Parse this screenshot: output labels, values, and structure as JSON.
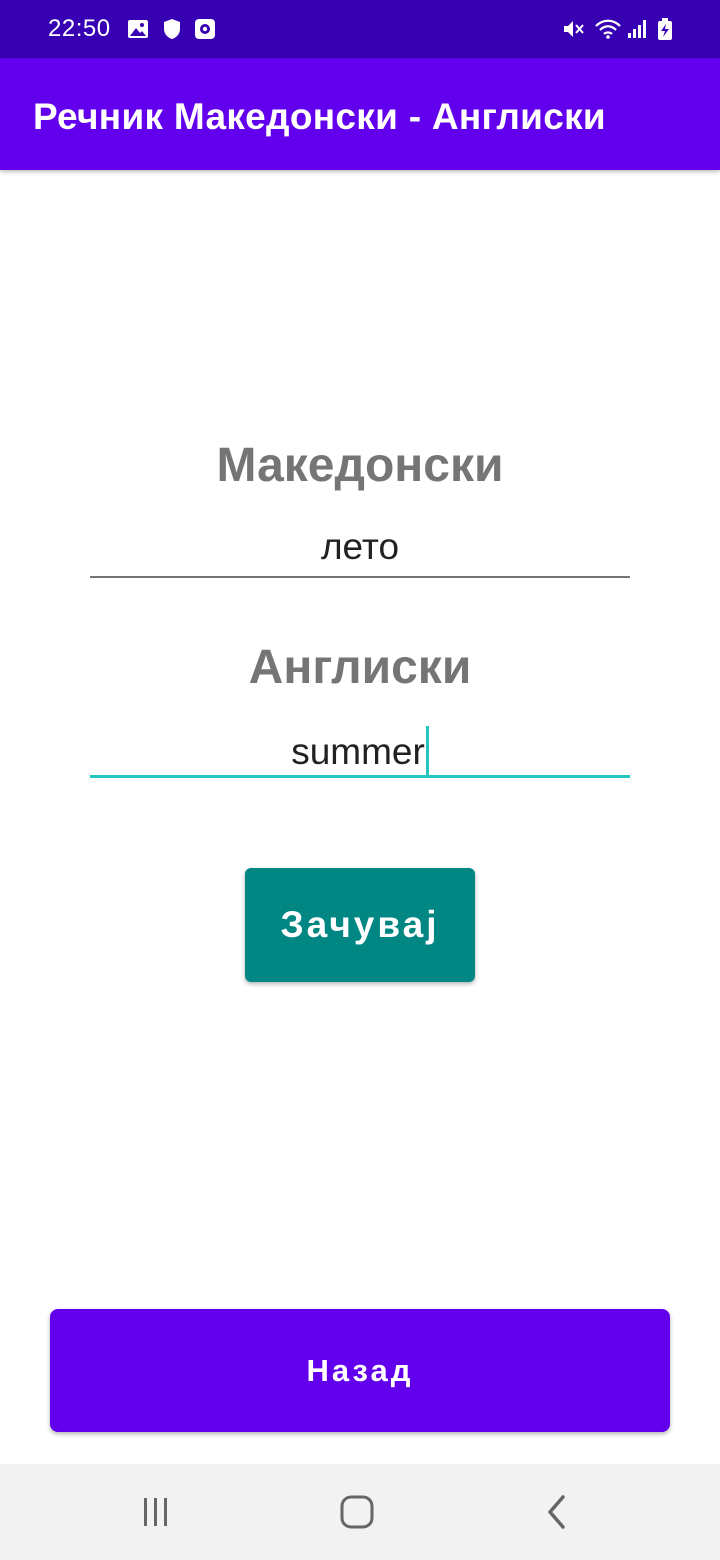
{
  "status_bar": {
    "time": "22:50",
    "left_icons": [
      "image-icon",
      "shield-icon",
      "screen-record-icon"
    ],
    "right_icons": [
      "mute-icon",
      "wifi-icon",
      "signal-icon",
      "battery-charging-icon"
    ]
  },
  "app_bar": {
    "title": "Речник Македонски - Англиски"
  },
  "form": {
    "macedonian_label": "Македонски",
    "macedonian_value": "лето",
    "english_label": "Англиски",
    "english_value": "summer",
    "save_label": "Зачувај"
  },
  "footer": {
    "back_label": "Назад"
  },
  "nav_bar": {
    "buttons": [
      "recent-apps-icon",
      "home-icon",
      "back-icon"
    ]
  },
  "colors": {
    "status_bar": "#3700b3",
    "primary": "#6200ee",
    "accent": "#26c6c0",
    "save_button": "#008784",
    "label_gray": "#757575"
  }
}
